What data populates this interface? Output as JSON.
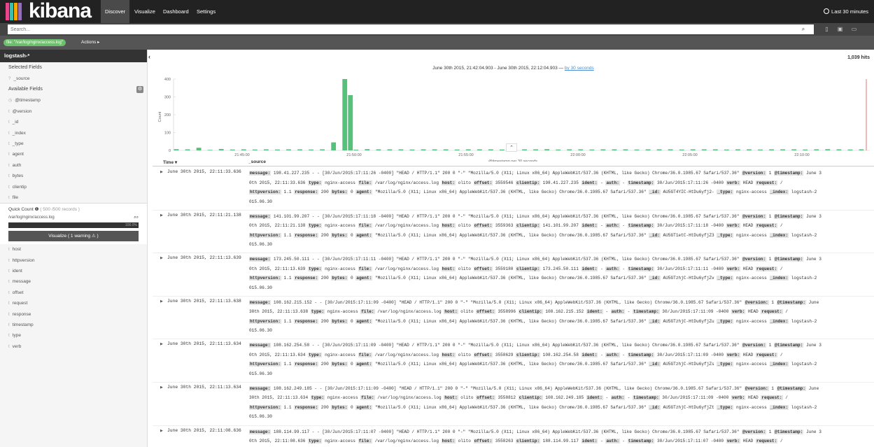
{
  "app": {
    "title": "kibana",
    "brand_colors": [
      "#e8478b",
      "#3ebeb0",
      "#f5a700",
      "#9170b8",
      "#00b3a4"
    ]
  },
  "nav": {
    "tabs": [
      {
        "label": "Discover",
        "active": true
      },
      {
        "label": "Visualize",
        "active": false
      },
      {
        "label": "Dashboard",
        "active": false
      },
      {
        "label": "Settings",
        "active": false
      }
    ]
  },
  "timepicker": {
    "label": "Last 30 minutes",
    "icon": "clock-icon"
  },
  "search": {
    "placeholder": "Search..."
  },
  "toolbar": {
    "icons": [
      "search-icon",
      "new-document-icon",
      "save-icon",
      "open-folder-icon"
    ]
  },
  "filter": {
    "label": "file: \"/var/log/nginx/access.log\"",
    "color": "#6dbf6d"
  },
  "actions": {
    "label": "Actions ▸"
  },
  "sidebar": {
    "index_pattern": "logstash-*",
    "selected_fields_title": "Selected Fields",
    "selected_fields": [
      {
        "type": "?",
        "name": "_source"
      }
    ],
    "available_fields_title": "Available Fields",
    "available_fields": [
      {
        "type": "◷",
        "name": "@timestamp"
      },
      {
        "type": "t",
        "name": "@version"
      },
      {
        "type": "t",
        "name": "_id"
      },
      {
        "type": "t",
        "name": "_index"
      },
      {
        "type": "t",
        "name": "_type"
      },
      {
        "type": "t",
        "name": "agent"
      },
      {
        "type": "t",
        "name": "auth"
      },
      {
        "type": "t",
        "name": "bytes"
      },
      {
        "type": "t",
        "name": "clientip"
      },
      {
        "type": "t",
        "name": "file"
      }
    ],
    "quick_count": {
      "title": "Quick Count",
      "records": "( 500 /500 records )",
      "value": "/var/log/nginx/access.log",
      "percent": 100.0,
      "percent_label": "100.0%"
    },
    "visualize_button": "Visualize  ( 1 warning ⚠ )",
    "more_fields": [
      {
        "type": "t",
        "name": "host"
      },
      {
        "type": "t",
        "name": "httpversion"
      },
      {
        "type": "t",
        "name": "ident"
      },
      {
        "type": "t",
        "name": "message"
      },
      {
        "type": "t",
        "name": "offset"
      },
      {
        "type": "t",
        "name": "request"
      },
      {
        "type": "t",
        "name": "response"
      },
      {
        "type": "t",
        "name": "timestamp"
      },
      {
        "type": "t",
        "name": "type"
      },
      {
        "type": "t",
        "name": "verb"
      }
    ]
  },
  "main": {
    "hits": "1,039 hits",
    "date_range": "June 30th 2015, 21:42:04.903 - June 30th 2015, 22:12:04.903 —",
    "interval_link": "by 30 seconds",
    "columns": {
      "time": "Time ▾",
      "source": "_source"
    }
  },
  "histogram": {
    "ylabel": "Count",
    "xlabel": "@timestamp per 30 seconds",
    "yticks": [
      0,
      100,
      200,
      300,
      400
    ],
    "xticks": [
      "21:45:00",
      "21:50:00",
      "21:55:00",
      "22:00:00",
      "22:05:00",
      "22:10:00"
    ],
    "bar_color": "#57c17b",
    "marker_color": "#d9534f",
    "values": [
      7,
      0,
      6,
      0,
      15,
      0,
      3,
      0,
      8,
      0,
      5,
      0,
      6,
      0,
      5,
      0,
      6,
      0,
      5,
      0,
      6,
      0,
      6,
      0,
      5,
      0,
      6,
      0,
      45,
      0,
      400,
      310,
      4,
      0,
      7,
      0,
      6,
      0,
      6,
      0,
      6,
      0,
      5,
      0,
      6,
      0,
      6,
      0,
      6,
      0,
      5,
      0,
      6,
      0,
      6,
      0,
      6,
      0,
      5,
      0,
      6,
      0,
      6,
      0,
      6,
      0,
      7,
      0,
      5,
      0,
      6,
      0,
      6,
      0,
      5,
      0,
      6,
      0,
      6,
      0,
      6,
      0,
      5,
      0,
      6,
      0,
      6,
      0,
      6,
      0,
      5,
      0,
      6,
      0,
      6,
      0,
      6,
      0,
      5,
      0,
      6,
      0,
      6,
      0,
      5,
      0,
      6,
      0,
      6,
      0,
      6,
      0,
      5,
      0,
      6,
      0,
      7,
      0,
      6,
      0,
      5,
      0,
      6,
      0
    ]
  },
  "docs": [
    {
      "time": "June 30th 2015, 22:11:33.636",
      "lines": [
        [
          [
            "message:",
            " 198.41.227.235 - - [30/Jun/2015:17:11:26 -0400] \"HEAD / HTTP/1.1\" 200 0 \"-\" \"Mozilla/5.0 (X11; Linux x86_64) AppleWebKit/537.36 (KHTML, like Gecko) Chrome/36.0.1985.67 Safari/537.36\" "
          ],
          [
            "@version:",
            " 1 "
          ],
          [
            "@timestamp:",
            " June 3"
          ]
        ],
        [
          [
            "",
            "0th 2015, 22:11:33.636 "
          ],
          [
            "type:",
            " nginx-access "
          ],
          [
            "file:",
            " /var/log/nginx/access.log "
          ],
          [
            "host:",
            " olito "
          ],
          [
            "offset:",
            " 3559546 "
          ],
          [
            "clientip:",
            " 198.41.227.235 "
          ],
          [
            "ident:",
            " - "
          ],
          [
            "auth:",
            " - "
          ],
          [
            "timestamp:",
            " 30/Jun/2015:17:11:26 -0400 "
          ],
          [
            "verb:",
            " HEAD "
          ],
          [
            "request:",
            " /"
          ]
        ],
        [
          [
            "httpversion:",
            " 1.1 "
          ],
          [
            "response:",
            " 200 "
          ],
          [
            "bytes:",
            " 0 "
          ],
          [
            "agent:",
            " \"Mozilla/5.0 (X11; Linux x86_64) AppleWebKit/537.36 (KHTML, like Gecko) Chrome/36.0.1985.67 Safari/537.36\" "
          ],
          [
            "_id:",
            " AU5GT4YIC-HtDu6yfj2- "
          ],
          [
            "_type:",
            " nginx-access "
          ],
          [
            "_index:",
            " logstash-2"
          ]
        ],
        [
          [
            "",
            "015.06.30"
          ]
        ]
      ]
    },
    {
      "time": "June 30th 2015, 22:11:21.138",
      "lines": [
        [
          [
            "message:",
            " 141.101.99.207 - - [30/Jun/2015:17:11:18 -0400] \"HEAD / HTTP/1.1\" 200 0 \"-\" \"Mozilla/5.0 (X11; Linux x86_64) AppleWebKit/537.36 (KHTML, like Gecko) Chrome/36.0.1985.67 Safari/537.36\" "
          ],
          [
            "@version:",
            " 1 "
          ],
          [
            "@timestamp:",
            " June 3"
          ]
        ],
        [
          [
            "",
            "0th 2015, 22:11:21.138 "
          ],
          [
            "type:",
            " nginx-access "
          ],
          [
            "file:",
            " /var/log/nginx/access.log "
          ],
          [
            "host:",
            " olito "
          ],
          [
            "offset:",
            " 3559363 "
          ],
          [
            "clientip:",
            " 141.101.99.207 "
          ],
          [
            "ident:",
            " - "
          ],
          [
            "auth:",
            " - "
          ],
          [
            "timestamp:",
            " 30/Jun/2015:17:11:18 -0400 "
          ],
          [
            "verb:",
            " HEAD "
          ],
          [
            "request:",
            " /"
          ]
        ],
        [
          [
            "httpversion:",
            " 1.1 "
          ],
          [
            "response:",
            " 200 "
          ],
          [
            "bytes:",
            " 0 "
          ],
          [
            "agent:",
            " \"Mozilla/5.0 (X11; Linux x86_64) AppleWebKit/537.36 (KHTML, like Gecko) Chrome/36.0.1985.67 Safari/537.36\" "
          ],
          [
            "_id:",
            " AU5GT1etC-HtDu6yfjZ3 "
          ],
          [
            "_type:",
            " nginx-access "
          ],
          [
            "_index:",
            " logstash-2"
          ]
        ],
        [
          [
            "",
            "015.06.30"
          ]
        ]
      ]
    },
    {
      "time": "June 30th 2015, 22:11:13.639",
      "lines": [
        [
          [
            "message:",
            " 173.245.50.111 - - [30/Jun/2015:17:11:11 -0400] \"HEAD / HTTP/1.1\" 200 0 \"-\" \"Mozilla/5.0 (X11; Linux x86_64) AppleWebKit/537.36 (KHTML, like Gecko) Chrome/36.0.1985.67 Safari/537.36\" "
          ],
          [
            "@version:",
            " 1 "
          ],
          [
            "@timestamp:",
            " June 3"
          ]
        ],
        [
          [
            "",
            "0th 2015, 22:11:13.639 "
          ],
          [
            "type:",
            " nginx-access "
          ],
          [
            "file:",
            " /var/log/nginx/access.log "
          ],
          [
            "host:",
            " olito "
          ],
          [
            "offset:",
            " 3559180 "
          ],
          [
            "clientip:",
            " 173.245.50.111 "
          ],
          [
            "ident:",
            " - "
          ],
          [
            "auth:",
            " - "
          ],
          [
            "timestamp:",
            " 30/Jun/2015:17:11:11 -0400 "
          ],
          [
            "verb:",
            " HEAD "
          ],
          [
            "request:",
            " /"
          ]
        ],
        [
          [
            "httpversion:",
            " 1.1 "
          ],
          [
            "response:",
            " 200 "
          ],
          [
            "bytes:",
            " 0 "
          ],
          [
            "agent:",
            " \"Mozilla/5.0 (X11; Linux x86_64) AppleWebKit/537.36 (KHTML, like Gecko) Chrome/36.0.1985.67 Safari/537.36\" "
          ],
          [
            "_id:",
            " AU5GTzhjC-HtDu6yfjZv "
          ],
          [
            "_type:",
            " nginx-access "
          ],
          [
            "_index:",
            " logstash-2"
          ]
        ],
        [
          [
            "",
            "015.06.30"
          ]
        ]
      ]
    },
    {
      "time": "June 30th 2015, 22:11:13.638",
      "lines": [
        [
          [
            "message:",
            " 108.162.215.152 - - [30/Jun/2015:17:11:09 -0400] \"HEAD / HTTP/1.1\" 200 0 \"-\" \"Mozilla/5.0 (X11; Linux x86_64) AppleWebKit/537.36 (KHTML, like Gecko) Chrome/36.0.1985.67 Safari/537.36\" "
          ],
          [
            "@version:",
            " 1 "
          ],
          [
            "@timestamp:",
            " June"
          ]
        ],
        [
          [
            "",
            "30th 2015, 22:11:13.638 "
          ],
          [
            "type:",
            " nginx-access "
          ],
          [
            "file:",
            " /var/log/nginx/access.log "
          ],
          [
            "host:",
            " olito "
          ],
          [
            "offset:",
            " 3558996 "
          ],
          [
            "clientip:",
            " 108.162.215.152 "
          ],
          [
            "ident:",
            " - "
          ],
          [
            "auth:",
            " - "
          ],
          [
            "timestamp:",
            " 30/Jun/2015:17:11:09 -0400 "
          ],
          [
            "verb:",
            " HEAD "
          ],
          [
            "request:",
            " /"
          ]
        ],
        [
          [
            "httpversion:",
            " 1.1 "
          ],
          [
            "response:",
            " 200 "
          ],
          [
            "bytes:",
            " 0 "
          ],
          [
            "agent:",
            " \"Mozilla/5.0 (X11; Linux x86_64) AppleWebKit/537.36 (KHTML, like Gecko) Chrome/36.0.1985.67 Safari/537.36\" "
          ],
          [
            "_id:",
            " AU5GTzhjC-HtDu6yfjZu "
          ],
          [
            "_type:",
            " nginx-access "
          ],
          [
            "_index:",
            " logstash-2"
          ]
        ],
        [
          [
            "",
            "015.06.30"
          ]
        ]
      ]
    },
    {
      "time": "June 30th 2015, 22:11:13.634",
      "lines": [
        [
          [
            "message:",
            " 108.162.254.58 - - [30/Jun/2015:17:11:09 -0400] \"HEAD / HTTP/1.1\" 200 0 \"-\" \"Mozilla/5.0 (X11; Linux x86_64) AppleWebKit/537.36 (KHTML, like Gecko) Chrome/36.0.1985.67 Safari/537.36\" "
          ],
          [
            "@version:",
            " 1 "
          ],
          [
            "@timestamp:",
            " June 3"
          ]
        ],
        [
          [
            "",
            "0th 2015, 22:11:13.634 "
          ],
          [
            "type:",
            " nginx-access "
          ],
          [
            "file:",
            " /var/log/nginx/access.log "
          ],
          [
            "host:",
            " olito "
          ],
          [
            "offset:",
            " 3558629 "
          ],
          [
            "clientip:",
            " 108.162.254.58 "
          ],
          [
            "ident:",
            " - "
          ],
          [
            "auth:",
            " - "
          ],
          [
            "timestamp:",
            " 30/Jun/2015:17:11:09 -0400 "
          ],
          [
            "verb:",
            " HEAD "
          ],
          [
            "request:",
            " /"
          ]
        ],
        [
          [
            "httpversion:",
            " 1.1 "
          ],
          [
            "response:",
            " 200 "
          ],
          [
            "bytes:",
            " 0 "
          ],
          [
            "agent:",
            " \"Mozilla/5.0 (X11; Linux x86_64) AppleWebKit/537.36 (KHTML, like Gecko) Chrome/36.0.1985.67 Safari/537.36\" "
          ],
          [
            "_id:",
            " AU5GTzhjC-HtDu6yfjZs "
          ],
          [
            "_type:",
            " nginx-access "
          ],
          [
            "_index:",
            " logstash-2"
          ]
        ],
        [
          [
            "",
            "015.06.30"
          ]
        ]
      ]
    },
    {
      "time": "June 30th 2015, 22:11:13.634",
      "lines": [
        [
          [
            "message:",
            " 108.162.249.185 - - [30/Jun/2015:17:11:09 -0400] \"HEAD / HTTP/1.1\" 200 0 \"-\" \"Mozilla/5.0 (X11; Linux x86_64) AppleWebKit/537.36 (KHTML, like Gecko) Chrome/36.0.1985.67 Safari/537.36\" "
          ],
          [
            "@version:",
            " 1 "
          ],
          [
            "@timestamp:",
            " June"
          ]
        ],
        [
          [
            "",
            "30th 2015, 22:11:13.634 "
          ],
          [
            "type:",
            " nginx-access "
          ],
          [
            "file:",
            " /var/log/nginx/access.log "
          ],
          [
            "host:",
            " olito "
          ],
          [
            "offset:",
            " 3558812 "
          ],
          [
            "clientip:",
            " 108.162.249.185 "
          ],
          [
            "ident:",
            " - "
          ],
          [
            "auth:",
            " - "
          ],
          [
            "timestamp:",
            " 30/Jun/2015:17:11:09 -0400 "
          ],
          [
            "verb:",
            " HEAD "
          ],
          [
            "request:",
            " /"
          ]
        ],
        [
          [
            "httpversion:",
            " 1.1 "
          ],
          [
            "response:",
            " 200 "
          ],
          [
            "bytes:",
            " 0 "
          ],
          [
            "agent:",
            " \"Mozilla/5.0 (X11; Linux x86_64) AppleWebKit/537.36 (KHTML, like Gecko) Chrome/36.0.1985.67 Safari/537.36\" "
          ],
          [
            "_id:",
            " AU5GTzhjC-HtDu6yfjZt "
          ],
          [
            "_type:",
            " nginx-access "
          ],
          [
            "_index:",
            " logstash-2"
          ]
        ],
        [
          [
            "",
            "015.06.30"
          ]
        ]
      ]
    },
    {
      "time": "June 30th 2015, 22:11:08.636",
      "lines": [
        [
          [
            "message:",
            " 188.114.99.117 - - [30/Jun/2015:17:11:07 -0400] \"HEAD / HTTP/1.1\" 200 0 \"-\" \"Mozilla/5.0 (X11; Linux x86_64) AppleWebKit/537.36 (KHTML, like Gecko) Chrome/36.0.1985.67 Safari/537.36\" "
          ],
          [
            "@version:",
            " 1 "
          ],
          [
            "@timestamp:",
            " June 3"
          ]
        ],
        [
          [
            "",
            "0th 2015, 22:11:08.636 "
          ],
          [
            "type:",
            " nginx-access "
          ],
          [
            "file:",
            " /var/log/nginx/access.log "
          ],
          [
            "host:",
            " olito "
          ],
          [
            "offset:",
            " 3558263 "
          ],
          [
            "clientip:",
            " 188.114.99.117 "
          ],
          [
            "ident:",
            " - "
          ],
          [
            "auth:",
            " - "
          ],
          [
            "timestamp:",
            " 30/Jun/2015:17:11:07 -0400 "
          ],
          [
            "verb:",
            " HEAD "
          ],
          [
            "request:",
            " /"
          ]
        ]
      ]
    }
  ]
}
